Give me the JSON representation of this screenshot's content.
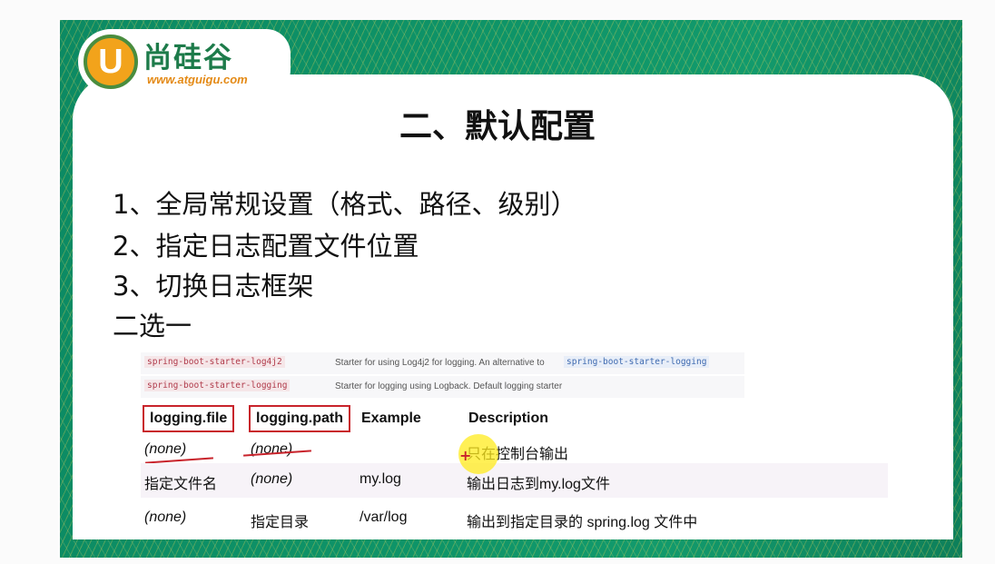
{
  "logo": {
    "letter": "U",
    "name": "尚硅谷",
    "url": "www.atguigu.com"
  },
  "title": "二、默认配置",
  "points": [
    "1、全局常规设置（格式、路径、级别）",
    "2、指定日志配置文件位置",
    "3、切换日志框架",
    "二选一"
  ],
  "starters": [
    {
      "code": "spring-boot-starter-log4j2",
      "description": "Starter for using Log4j2 for logging. An alternative to",
      "link": "spring-boot-starter-logging"
    },
    {
      "code": "spring-boot-starter-logging",
      "description": "Starter for logging using Logback. Default logging starter"
    }
  ],
  "table": {
    "headers": [
      "logging.file",
      "logging.path",
      "Example",
      "Description"
    ],
    "rows": [
      [
        "(none)",
        "(none)",
        "",
        "只在控制台输出"
      ],
      [
        "指定文件名",
        "(none)",
        "my.log",
        "输出日志到my.log文件"
      ],
      [
        "(none)",
        "指定目录",
        "/var/log",
        "输出到指定目录的 spring.log 文件中"
      ]
    ]
  },
  "colors": {
    "banner_green": "#0e9468",
    "highlight_red": "#c8232b",
    "cursor_yellow": "#ffeb1e"
  }
}
